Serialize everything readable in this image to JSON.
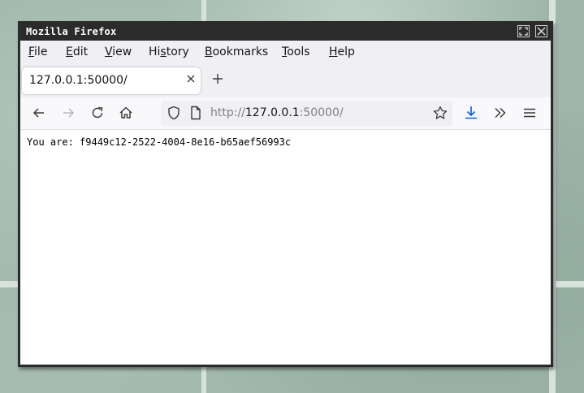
{
  "window": {
    "title": "Mozilla Firefox",
    "maximize_icon": "maximize-icon",
    "close_icon": "close-icon"
  },
  "menubar": {
    "items": [
      {
        "label": "File",
        "access_key": "F"
      },
      {
        "label": "Edit",
        "access_key": "E"
      },
      {
        "label": "View",
        "access_key": "V"
      },
      {
        "label": "History",
        "access_key": "s"
      },
      {
        "label": "Bookmarks",
        "access_key": "B"
      },
      {
        "label": "Tools",
        "access_key": "T"
      },
      {
        "label": "Help",
        "access_key": "H"
      }
    ]
  },
  "tabs": {
    "active_tab": {
      "title": "127.0.0.1:50000/",
      "close_icon": "close-tab-icon"
    },
    "new_tab_icon": "plus-icon"
  },
  "navbar": {
    "icons": [
      "back-arrow-icon",
      "forward-arrow-icon",
      "reload-icon",
      "home-icon",
      "shield-icon",
      "page-icon",
      "star-icon",
      "download-icon",
      "overflow-chevron-icon",
      "hamburger-menu-icon"
    ],
    "url_scheme": "http://",
    "url_host": "127.0.0.1",
    "url_rest": ":50000/",
    "accent_color": "#0061e0"
  },
  "page": {
    "content": "You are: f9449c12-2522-4004-8e16-b65aef56993c"
  }
}
